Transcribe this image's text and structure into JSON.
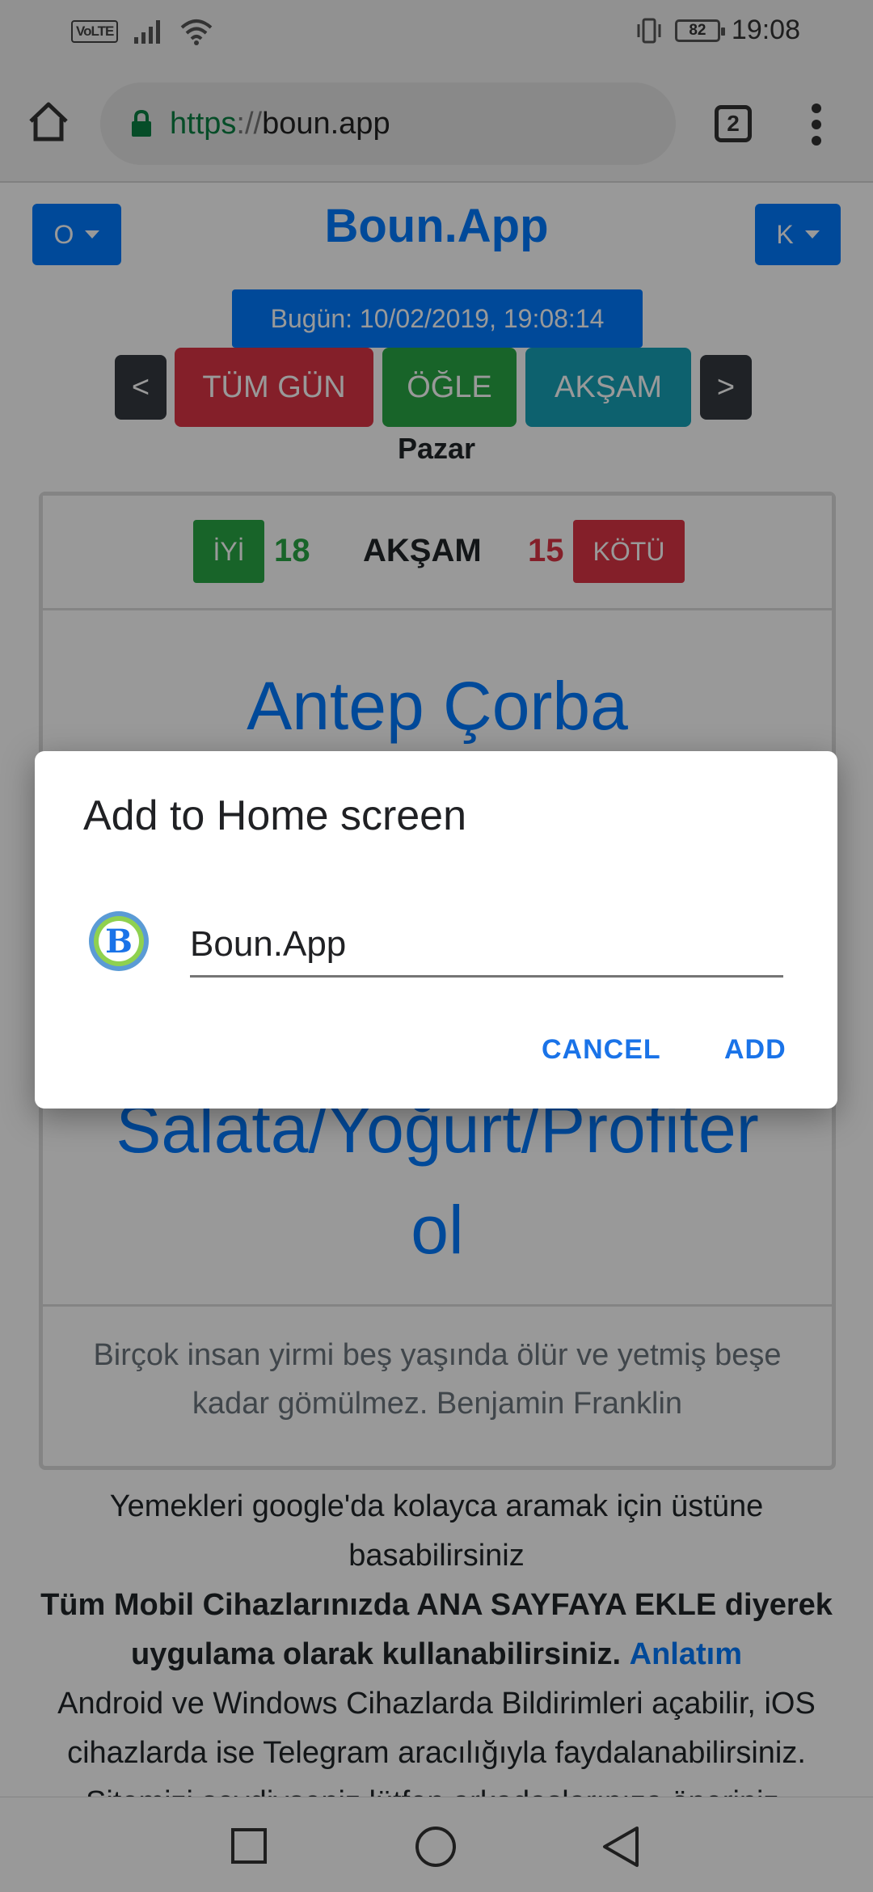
{
  "status_bar": {
    "volte": "VoLTE",
    "battery": "82",
    "time": "19:08"
  },
  "browser": {
    "url_scheme": "https",
    "url_sep": "://",
    "url_host": "boun.app",
    "tab_count": "2"
  },
  "header": {
    "left_dropdown": "O",
    "title": "Boun.App",
    "right_dropdown": "K"
  },
  "today": "Bugün: 10/02/2019, 19:08:14",
  "meal_nav": {
    "prev": "<",
    "all_day": "TÜM GÜN",
    "lunch": "ÖĞLE",
    "dinner": "AKŞAM",
    "next": ">"
  },
  "day": "Pazar",
  "card": {
    "good_label": "İYİ",
    "good_count": "18",
    "meal": "AKŞAM",
    "bad_count": "15",
    "bad_label": "KÖTÜ",
    "dish_1": "Antep Çorba",
    "dish_2_line1": "Salata/Yoğurt/Profiter",
    "dish_2_line2": "ol",
    "quote": "Birçok insan yirmi beş yaşında ölür ve yetmiş beşe kadar gömülmez. Benjamin Franklin"
  },
  "info": {
    "google_tip": "Yemekleri google'da kolayca aramak için üstüne basabilirsiniz",
    "home_screen_tip": "Tüm Mobil Cihazlarınızda ANA SAYFAYA EKLE diyerek uygulama olarak kullanabilirsiniz.",
    "tutorial_link": "Anlatım",
    "notifications_tip": "Android ve Windows Cihazlarda Bildirimleri açabilir, iOS cihazlarda ise Telegram aracılığıyla faydalanabilirsiniz.",
    "share_tip": "Sitemizi sevdiyseniz lütfen arkadaşlarınıza öneriniz."
  },
  "dialog": {
    "title": "Add to Home screen",
    "icon_letter": "B",
    "app_name": "Boun.App",
    "cancel": "CANCEL",
    "add": "ADD"
  },
  "colors": {
    "primary": "#007bff",
    "success": "#28a745",
    "danger": "#dc3545",
    "info": "#17a2b8",
    "dark": "#343a40",
    "dialog_accent": "#1a73e8"
  }
}
